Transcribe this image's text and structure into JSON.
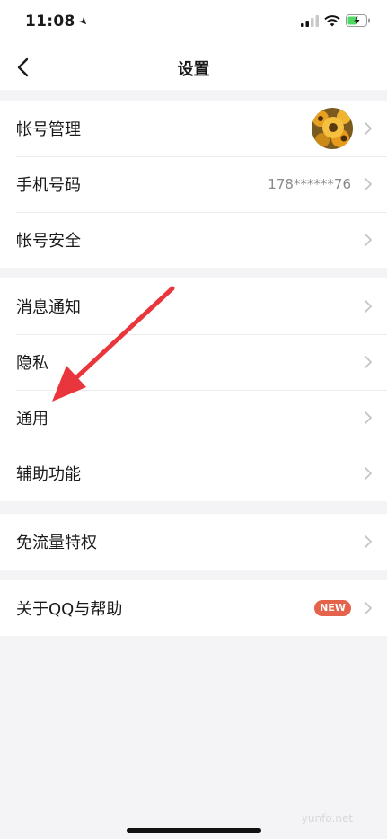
{
  "status_bar": {
    "time": "11:08"
  },
  "nav": {
    "title": "设置"
  },
  "groups": [
    {
      "rows": [
        {
          "label": "帐号管理"
        },
        {
          "label": "手机号码",
          "value": "178******76"
        },
        {
          "label": "帐号安全"
        }
      ]
    },
    {
      "rows": [
        {
          "label": "消息通知"
        },
        {
          "label": "隐私"
        },
        {
          "label": "通用"
        },
        {
          "label": "辅助功能"
        }
      ]
    },
    {
      "rows": [
        {
          "label": "免流量特权"
        }
      ]
    },
    {
      "rows": [
        {
          "label": "关于QQ与帮助",
          "badge": "NEW"
        }
      ]
    }
  ],
  "watermark": "yunfo.net",
  "colors": {
    "badge": "#e5634a",
    "annotation_arrow": "#e8363c",
    "background": "#f4f4f7"
  },
  "icons": [
    "location-arrow-icon",
    "cellular-signal-icon",
    "wifi-icon",
    "battery-charging-icon",
    "back-chevron-icon",
    "chevron-right-icon",
    "sunflower-avatar"
  ]
}
